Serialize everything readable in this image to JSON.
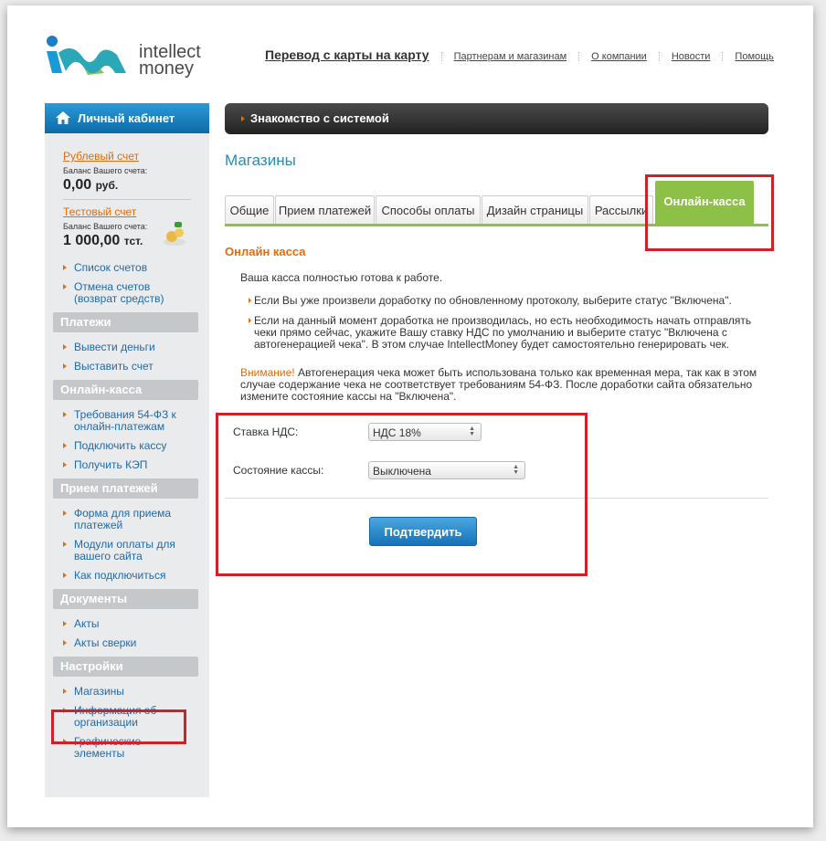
{
  "brand": {
    "logo_line1": "intellect",
    "logo_line2": "money"
  },
  "topnav": {
    "main": "Перевод с карты на карту",
    "links": [
      "Партнерам и магазинам",
      "О компании",
      "Новости",
      "Помощь"
    ]
  },
  "sidebar": {
    "header": "Личный кабинет",
    "accounts": [
      {
        "title": "Рублевый счет",
        "label": "Баланс Вашего счета:",
        "amount": "0,00",
        "currency": "руб."
      },
      {
        "title": "Тестовый счет",
        "label": "Баланс Вашего счета:",
        "amount": "1 000,00",
        "currency": "тст."
      }
    ],
    "account_links": [
      "Список счетов",
      "Отмена счетов (возврат средств)"
    ],
    "sections": [
      {
        "title": "Платежи",
        "items": [
          "Вывести деньги",
          "Выставить счет"
        ]
      },
      {
        "title": "Онлайн-касса",
        "items": [
          "Требования 54-ФЗ к онлайн-платежам",
          "Подключить кассу",
          "Получить КЭП"
        ]
      },
      {
        "title": "Прием платежей",
        "items": [
          "Форма для приема платежей",
          "Модули оплаты для вашего сайта",
          "Как подключиться"
        ]
      },
      {
        "title": "Документы",
        "items": [
          "Акты",
          "Акты сверки"
        ]
      },
      {
        "title": "Настройки",
        "items": [
          "Магазины",
          "Информация об организации",
          "Графические элементы"
        ]
      }
    ]
  },
  "main": {
    "bar_title": "Знакомство с системой",
    "page_title": "Магазины",
    "tabs": [
      "Общие",
      "Прием платежей",
      "Способы оплаты",
      "Дизайн страницы",
      "Рассылки",
      "Онлайн-касса"
    ],
    "active_tab": "Онлайн-касса",
    "section_title": "Онлайн касса",
    "intro": "Ваша касса полностью готова к работе.",
    "bullet1": "Если Вы уже произвели доработку по обновленному протоколу, выберите статус \"Включена\".",
    "bullet2": "Если на данный момент доработка не производилась, но есть необходимость начать отправлять чеки прямо сейчас, укажите Вашу ставку НДС по умолчанию и выберите статус \"Включена с автогенерацией чека\". В этом случае IntellectMoney будет самостоятельно генерировать чек.",
    "warning_label": "Внимание!",
    "warning_text": " Автогенерация чека может быть использована только как временная мера, так как в этом случае содержание чека не соответствует требованиям 54-ФЗ. После доработки сайта обязательно измените состояние кассы на \"Включена\".",
    "vat_label": "Ставка НДС:",
    "vat_value": "НДС 18%",
    "state_label": "Состояние кассы:",
    "state_value": "Выключена",
    "confirm": "Подтвердить"
  },
  "colors": {
    "accent": "#e36c0a",
    "link": "#1f6aa8",
    "tab_active": "#8dc046",
    "highlight": "#d0202a"
  }
}
